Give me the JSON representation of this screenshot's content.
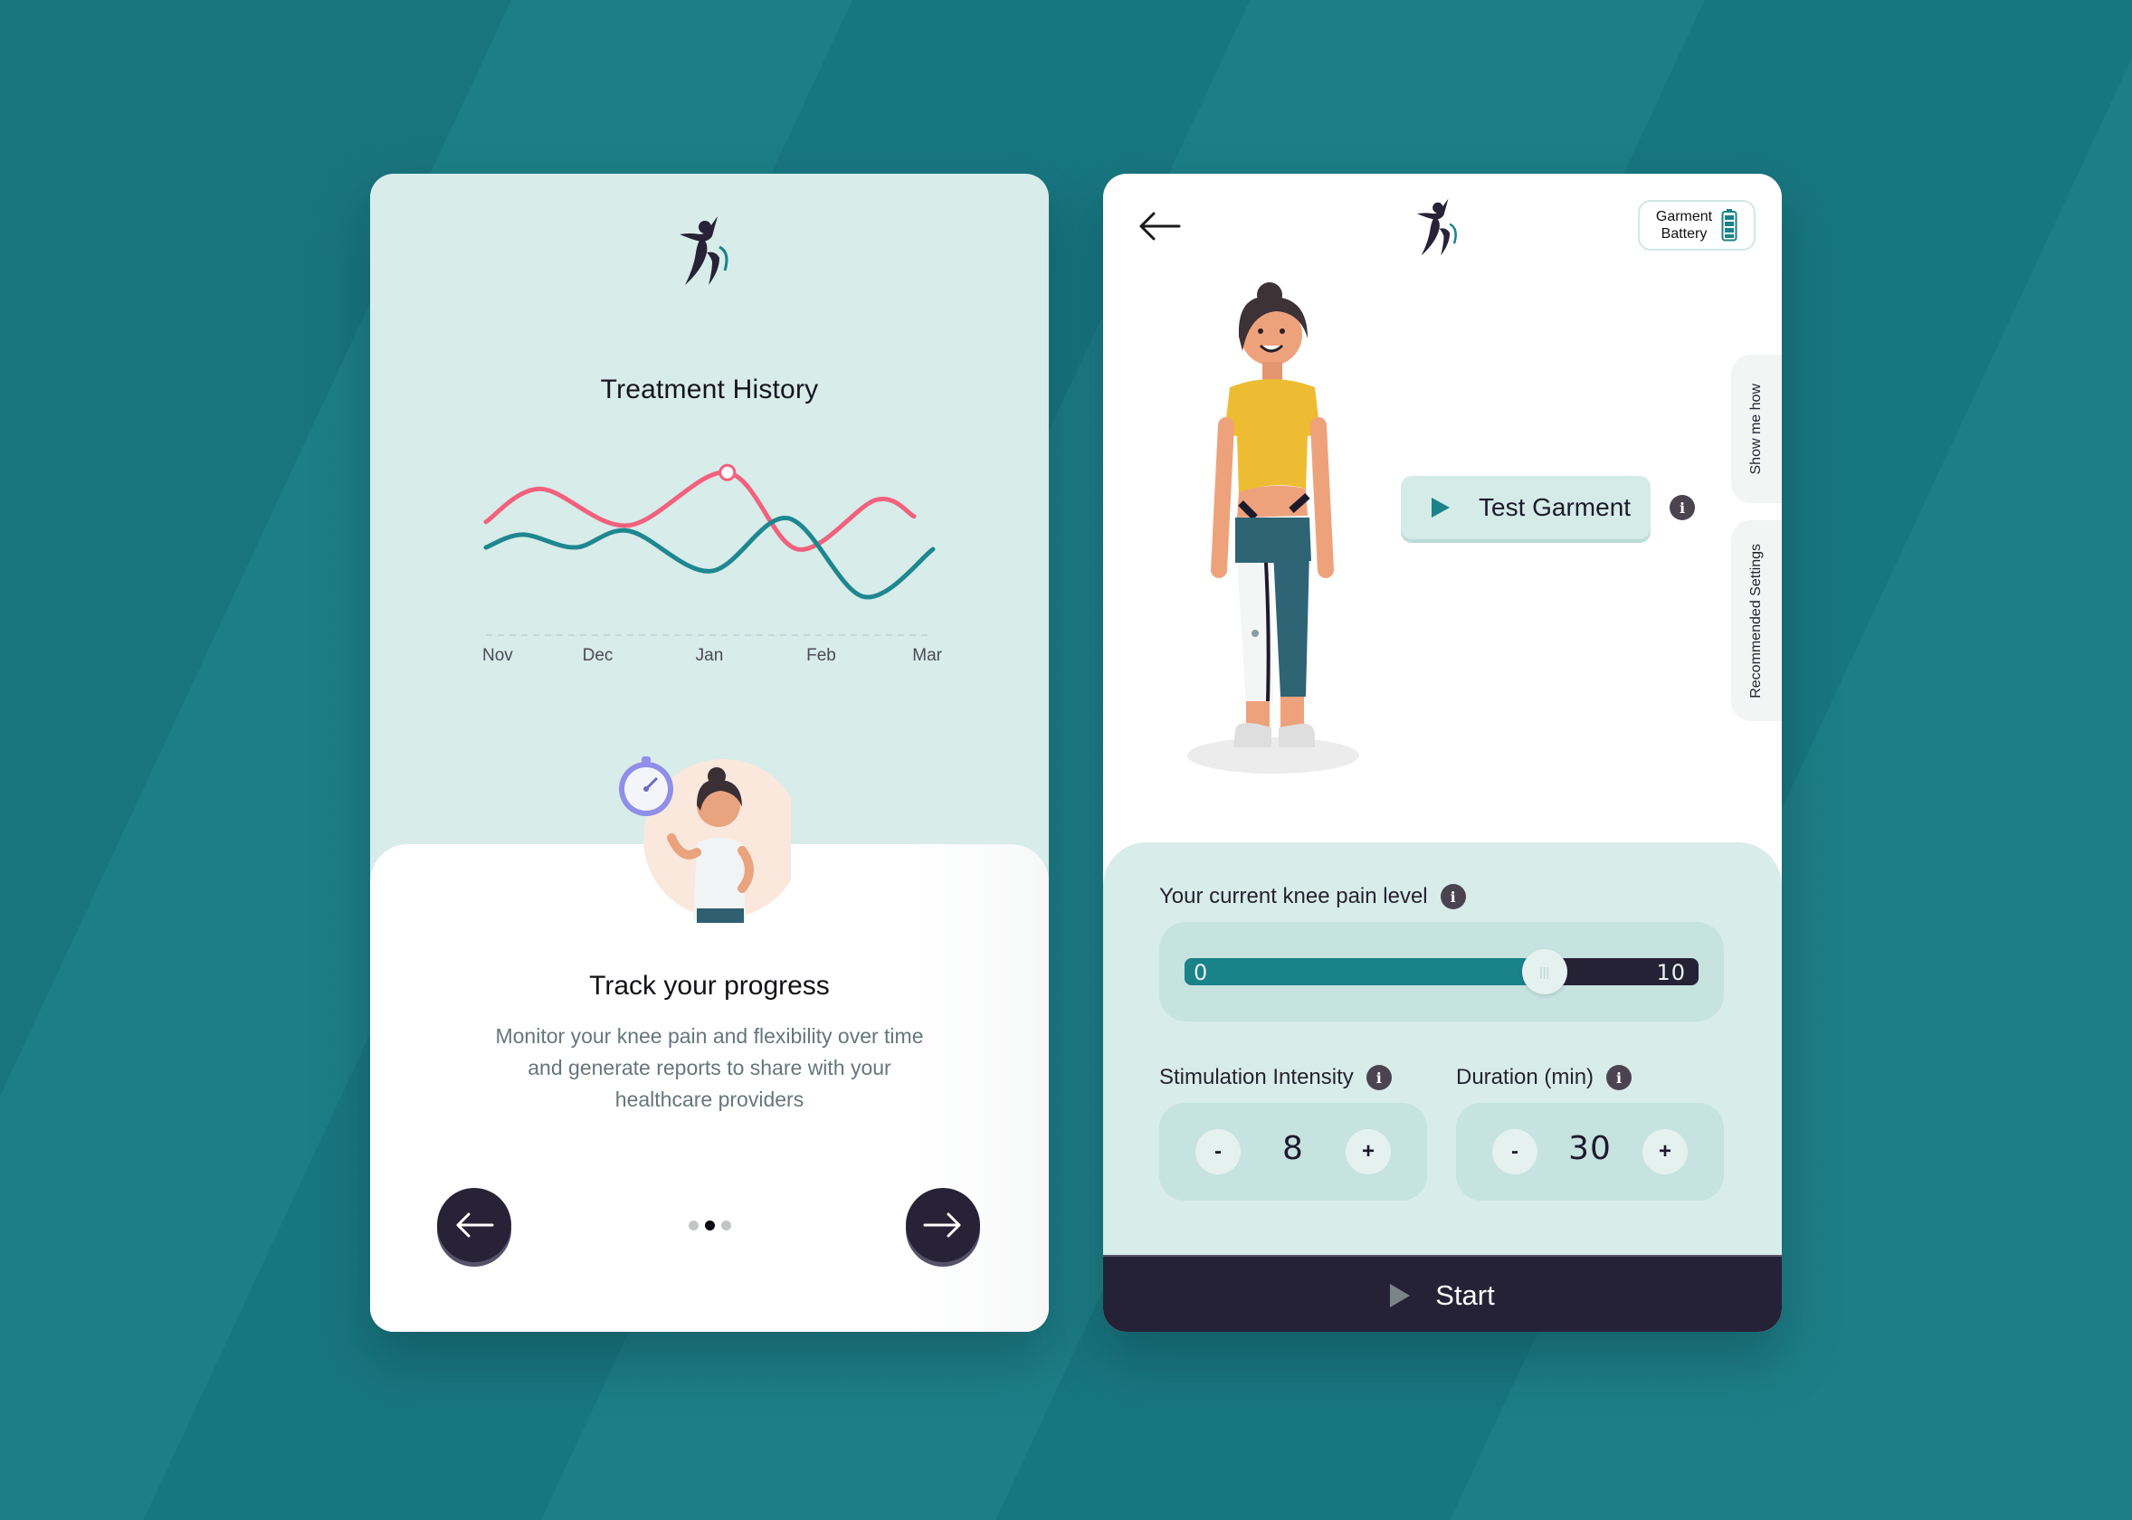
{
  "colors": {
    "background": "#197b85",
    "card_mint": "#d8ecea",
    "teal_accent": "#1a8289",
    "pink_accent": "#f2617d",
    "dark": "#262236"
  },
  "left_card": {
    "logo_icon": "dancing-figure-logo",
    "title": "Treatment History",
    "onboarding": {
      "title": "Track your progress",
      "description": "Monitor your knee pain and flexibility over time and generate reports to share with your healthcare providers",
      "illustration": "woman-with-stopwatch",
      "prev_icon": "arrow-left-icon",
      "next_icon": "arrow-right-icon",
      "page_count": 3,
      "active_page": 2
    }
  },
  "chart_data": {
    "type": "line",
    "title": "Treatment History",
    "xlabel": "",
    "ylabel": "",
    "categories": [
      "Nov",
      "Dec",
      "Jan",
      "Feb",
      "Mar"
    ],
    "x_range": [
      0,
      4
    ],
    "ylim": [
      0,
      100
    ],
    "grid": false,
    "baseline": "dashed",
    "legend": "none",
    "series": [
      {
        "name": "Series A (pink)",
        "color": "#f2617d",
        "x": [
          0,
          0.49,
          1.27,
          2.16,
          2.79,
          3.49,
          3.83
        ],
        "y": [
          62,
          80,
          60,
          89,
          47,
          74,
          65
        ]
      },
      {
        "name": "Series B (teal)",
        "color": "#1e8790",
        "x": [
          0,
          0.33,
          0.8,
          1.28,
          2.01,
          2.7,
          3.38,
          4.0
        ],
        "y": [
          48,
          55,
          48,
          57,
          35,
          64,
          21,
          47
        ]
      }
    ],
    "annotations": [
      {
        "series": "Series A (pink)",
        "x": 2.16,
        "y": 89,
        "marker": "hollow-circle"
      }
    ]
  },
  "right_card": {
    "back_icon": "arrow-left-icon",
    "logo_icon": "dancing-figure-logo",
    "battery": {
      "label_line1": "Garment",
      "label_line2": "Battery",
      "icon": "battery-full-icon",
      "level": "full"
    },
    "illustration": "woman-wearing-knee-garment",
    "test_button": {
      "label": "Test Garment",
      "icon": "play-icon"
    },
    "side_tabs": [
      "Show me how",
      "Recommended Settings"
    ],
    "pain": {
      "label": "Your current knee pain level",
      "min_label": "0",
      "max_label": "10",
      "min": 0,
      "max": 10,
      "value": 7
    },
    "intensity": {
      "label": "Stimulation Intensity",
      "value": "8",
      "minus": "-",
      "plus": "+"
    },
    "duration": {
      "label": "Duration (min)",
      "value": "30",
      "minus": "-",
      "plus": "+"
    },
    "info_glyph": "i",
    "start": {
      "label": "Start",
      "icon": "play-icon"
    }
  }
}
